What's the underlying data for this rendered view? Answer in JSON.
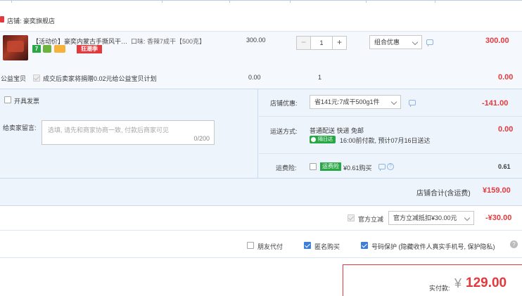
{
  "shop": {
    "prefix": "店铺:",
    "name": "豪奕旗舰店"
  },
  "item": {
    "title": "【活动价】豪奕内蒙古手撕风干…",
    "flavor": "口味: 香辣7成干【500克】",
    "badge_seven": "7",
    "badge_promo": "狂潮季",
    "unit_price": "300.00",
    "quantity": "1",
    "promo_select": "组合优惠",
    "subtotal": "300.00"
  },
  "charity": {
    "label": "公益宝贝",
    "desc": "成交后卖家将捐赠0.02元给公益宝贝计划",
    "price": "0.00",
    "qty": "1",
    "total": "0.00"
  },
  "invoice": {
    "label": "开具发票"
  },
  "message": {
    "label": "给卖家留言:",
    "placeholder": "选填, 请先和商家协商一致, 付款后商家可见",
    "counter": "0/200"
  },
  "shop_discount": {
    "label": "店铺优惠:",
    "select": "省141元:7成干500g1件",
    "amount": "-141.00"
  },
  "delivery": {
    "label": "运送方式:",
    "method": "普通配送 快递 免邮",
    "tag": "隔日达",
    "eta": "16:00前付款, 预计07月16日送达",
    "amount": "0.00"
  },
  "insurance": {
    "label": "运费险:",
    "tag": "运费险",
    "desc": "¥0.61购买",
    "amount": "0.61"
  },
  "shop_total": {
    "label": "店铺合计(含运费)",
    "amount": "¥159.00"
  },
  "instant_discount": {
    "label": "官方立减",
    "select": "官方立减抵扣¥30.00元",
    "amount": "-¥30.00"
  },
  "options": {
    "friend_pay": "朋友代付",
    "anonymous": "匿名购买",
    "privacy": "号码保护 (隐藏收件人真实手机号, 保护隐私)"
  },
  "payment": {
    "label": "实付款:",
    "currency": "¥",
    "amount": "129.00"
  },
  "colors": {
    "accent": "#e4393c",
    "blue": "#3d7fd8",
    "panel": "#eef4fc",
    "border": "#b9cde5"
  }
}
